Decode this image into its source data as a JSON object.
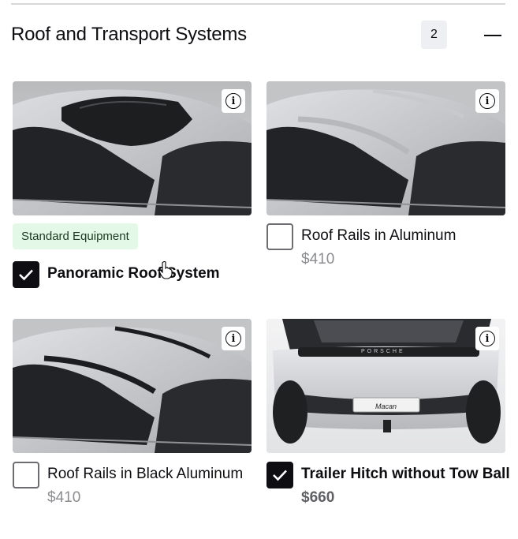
{
  "section": {
    "title": "Roof and Transport Systems",
    "count": "2"
  },
  "options": [
    {
      "name": "Panoramic Roof System",
      "badge": "Standard Equipment",
      "price": "",
      "checked": true,
      "image_icon": "car-panoramic-roof-image"
    },
    {
      "name": "Roof Rails in Aluminum",
      "badge": "",
      "price": "$410",
      "checked": false,
      "image_icon": "car-roof-rails-aluminum-image"
    },
    {
      "name": "Roof Rails in Black Aluminum",
      "badge": "",
      "price": "$410",
      "checked": false,
      "image_icon": "car-roof-rails-black-image"
    },
    {
      "name": "Trailer Hitch without Tow Ball",
      "badge": "",
      "price": "$660",
      "checked": true,
      "image_icon": "car-rear-trailer-hitch-image"
    }
  ],
  "rear_badge": {
    "brand": "PORSCHE",
    "model": "Macan"
  },
  "colors": {
    "standard_badge_bg": "#e4f8e8",
    "checked_bg": "#0e0e12",
    "price_gray": "#8b8d90"
  }
}
